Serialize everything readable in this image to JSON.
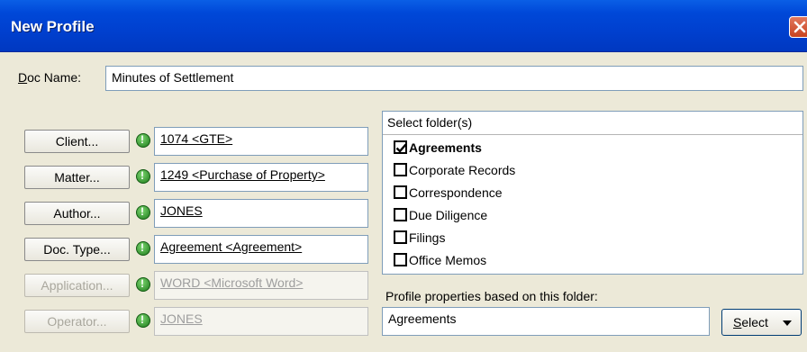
{
  "window": {
    "title": "New Profile"
  },
  "doc_name": {
    "label_prefix": "D",
    "label_rest": "oc Name:",
    "value": "Minutes of Settlement"
  },
  "lookups": [
    {
      "button": "Client...",
      "value": "1074 <GTE>",
      "enabled": true
    },
    {
      "button": "Matter...",
      "value": "1249 <Purchase of Property>",
      "enabled": true
    },
    {
      "button": "Author...",
      "value": "JONES",
      "enabled": true
    },
    {
      "button": "Doc. Type...",
      "value": "Agreement <Agreement>",
      "enabled": true
    },
    {
      "button": "Application...",
      "value": "WORD <Microsoft Word>",
      "enabled": false
    },
    {
      "button": "Operator...",
      "value": "JONES",
      "enabled": false
    }
  ],
  "folders": {
    "header": "Select folder(s)",
    "items": [
      {
        "label": "Agreements",
        "checked": true
      },
      {
        "label": "Corporate Records",
        "checked": false
      },
      {
        "label": "Correspondence",
        "checked": false
      },
      {
        "label": "Due Diligence",
        "checked": false
      },
      {
        "label": "Filings",
        "checked": false
      },
      {
        "label": "Office Memos",
        "checked": false
      }
    ]
  },
  "profile_properties": {
    "label": "Profile properties based on this folder:",
    "value": "Agreements",
    "select_prefix": "S",
    "select_rest": "elect"
  },
  "icons": {
    "required": "required-field-icon",
    "close": "close-icon",
    "check": "check-icon",
    "dropdown": "chevron-down-icon"
  },
  "colors": {
    "title_bar": "#0048d8",
    "required_icon": "#1e7a1c",
    "dialog_bg": "#ece9d8"
  }
}
